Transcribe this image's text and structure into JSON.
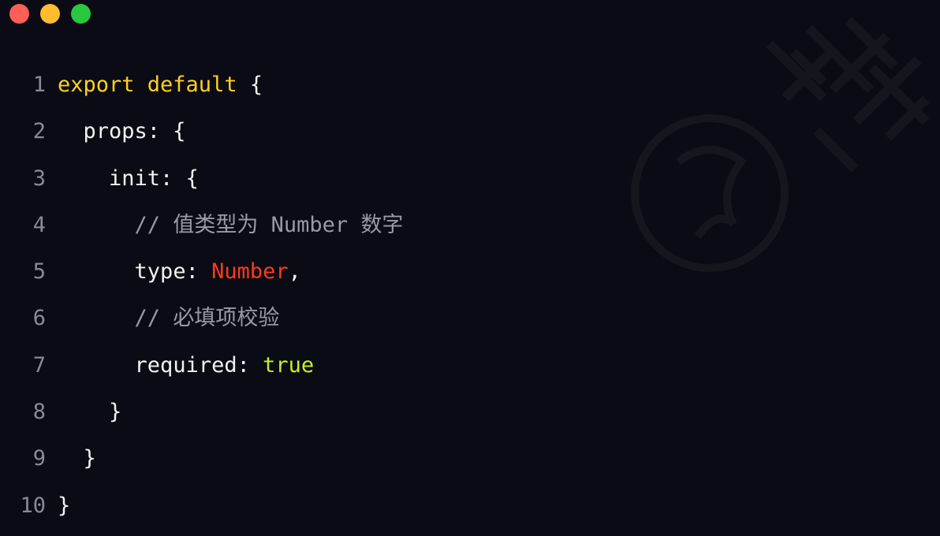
{
  "window": {
    "controls": {
      "close_color": "#ff5f57",
      "minimize_color": "#febc2e",
      "maximize_color": "#28c840"
    }
  },
  "editor": {
    "theme": {
      "background": "#0b0b15",
      "keyword_color": "#ffd21e",
      "comment_color": "#9a9aa4",
      "type_color": "#ff3b1a",
      "boolean_color": "#c6f01e",
      "text_color": "#f2f2f2",
      "line_number_color": "#8a8a94"
    },
    "lines": [
      {
        "number": "1",
        "indent": "",
        "tokens": [
          {
            "t": "export default",
            "c": "kw"
          },
          {
            "t": " {",
            "c": "tx"
          }
        ]
      },
      {
        "number": "2",
        "indent": "  ",
        "tokens": [
          {
            "t": "props: {",
            "c": "tx"
          }
        ]
      },
      {
        "number": "3",
        "indent": "    ",
        "tokens": [
          {
            "t": "init: {",
            "c": "tx"
          }
        ]
      },
      {
        "number": "4",
        "indent": "      ",
        "tokens": [
          {
            "t": "// 值类型为 Number 数字",
            "c": "cm"
          }
        ]
      },
      {
        "number": "5",
        "indent": "      ",
        "tokens": [
          {
            "t": "type: ",
            "c": "tx"
          },
          {
            "t": "Number",
            "c": "num"
          },
          {
            "t": ",",
            "c": "tx"
          }
        ]
      },
      {
        "number": "6",
        "indent": "      ",
        "tokens": [
          {
            "t": "// 必填项校验",
            "c": "cm"
          }
        ]
      },
      {
        "number": "7",
        "indent": "      ",
        "tokens": [
          {
            "t": "required: ",
            "c": "tx"
          },
          {
            "t": "true",
            "c": "bool"
          }
        ]
      },
      {
        "number": "8",
        "indent": "    ",
        "tokens": [
          {
            "t": "}",
            "c": "tx"
          }
        ]
      },
      {
        "number": "9",
        "indent": "  ",
        "tokens": [
          {
            "t": "}",
            "c": "tx"
          }
        ]
      },
      {
        "number": "10",
        "indent": "",
        "tokens": [
          {
            "t": "}",
            "c": "tx"
          }
        ]
      }
    ]
  }
}
